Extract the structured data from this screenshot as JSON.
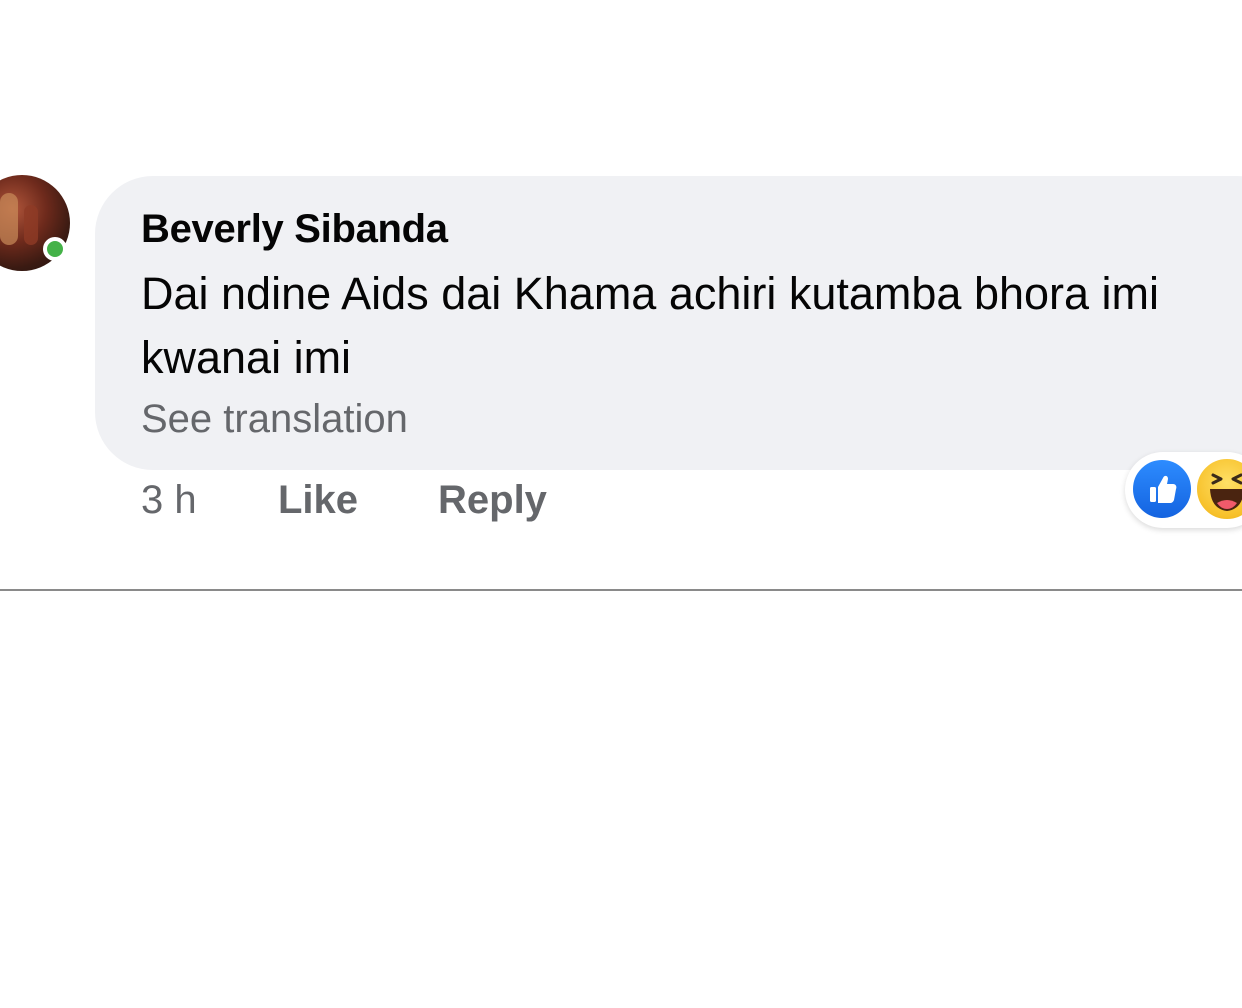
{
  "comment": {
    "author": "Beverly Sibanda",
    "text": "Dai ndine Aids dai Khama achiri kutamba bhora imi kwanai imi",
    "translate_label": "See translation",
    "time": "3 h",
    "like_label": "Like",
    "reply_label": "Reply",
    "online": true,
    "reactions": [
      "like-icon",
      "haha-icon"
    ]
  },
  "colors": {
    "bubble": "#f0f1f4",
    "online": "#44b248",
    "like_blue": "#1877f2",
    "secondary_text": "#65676b"
  }
}
